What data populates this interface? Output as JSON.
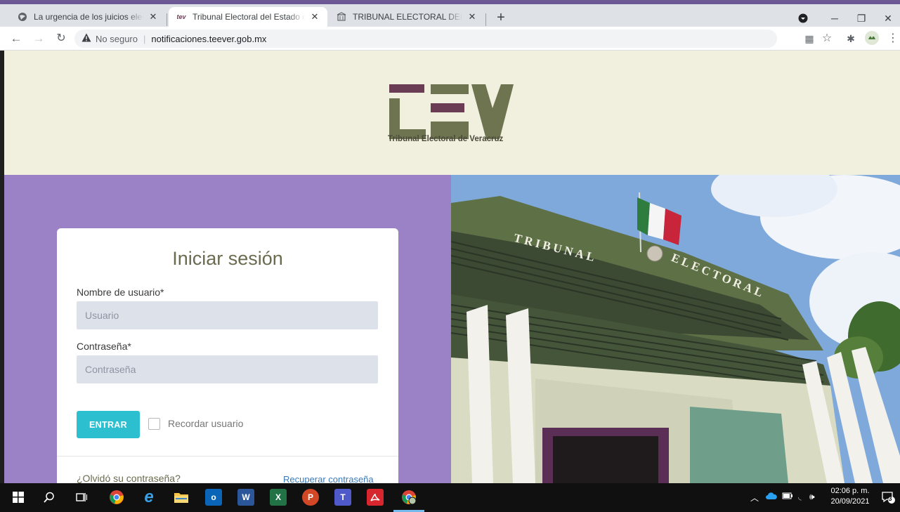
{
  "browser": {
    "tabs": [
      {
        "title": "La urgencia de los juicios electorales",
        "favicon": "globe-icon"
      },
      {
        "title": "Tribunal Electoral del Estado de Veracruz",
        "favicon": "tev-favicon",
        "favicon_text": "tev"
      },
      {
        "title": "TRIBUNAL ELECTORAL DEL ESTADO",
        "favicon": "building-icon"
      }
    ],
    "security_label": "No seguro",
    "url": "notificaciones.teever.gob.mx"
  },
  "header": {
    "logo_caption": "Tribunal Electoral de Veracruz",
    "colors": {
      "bg": "#f1efdd",
      "logo_purple": "#6b3d55",
      "logo_olive": "#6e744f"
    }
  },
  "photo": {
    "sign_line1": "TRIBUNAL",
    "sign_line2": "ELECTORAL"
  },
  "login": {
    "title": "Iniciar sesión",
    "username_label": "Nombre de usuario*",
    "username_placeholder": "Usuario",
    "password_label": "Contraseña*",
    "password_placeholder": "Contraseña",
    "submit_label": "ENTRAR",
    "remember_label": "Recordar usuario",
    "forgot_label": "¿Olvidó su contraseña?",
    "recover_link": "Recuperar contraseña",
    "colors": {
      "panel": "#9b82c6",
      "button": "#2cbfcf"
    }
  },
  "taskbar": {
    "time": "02:06 p. m.",
    "date": "20/09/2021",
    "notification_count": "3"
  }
}
